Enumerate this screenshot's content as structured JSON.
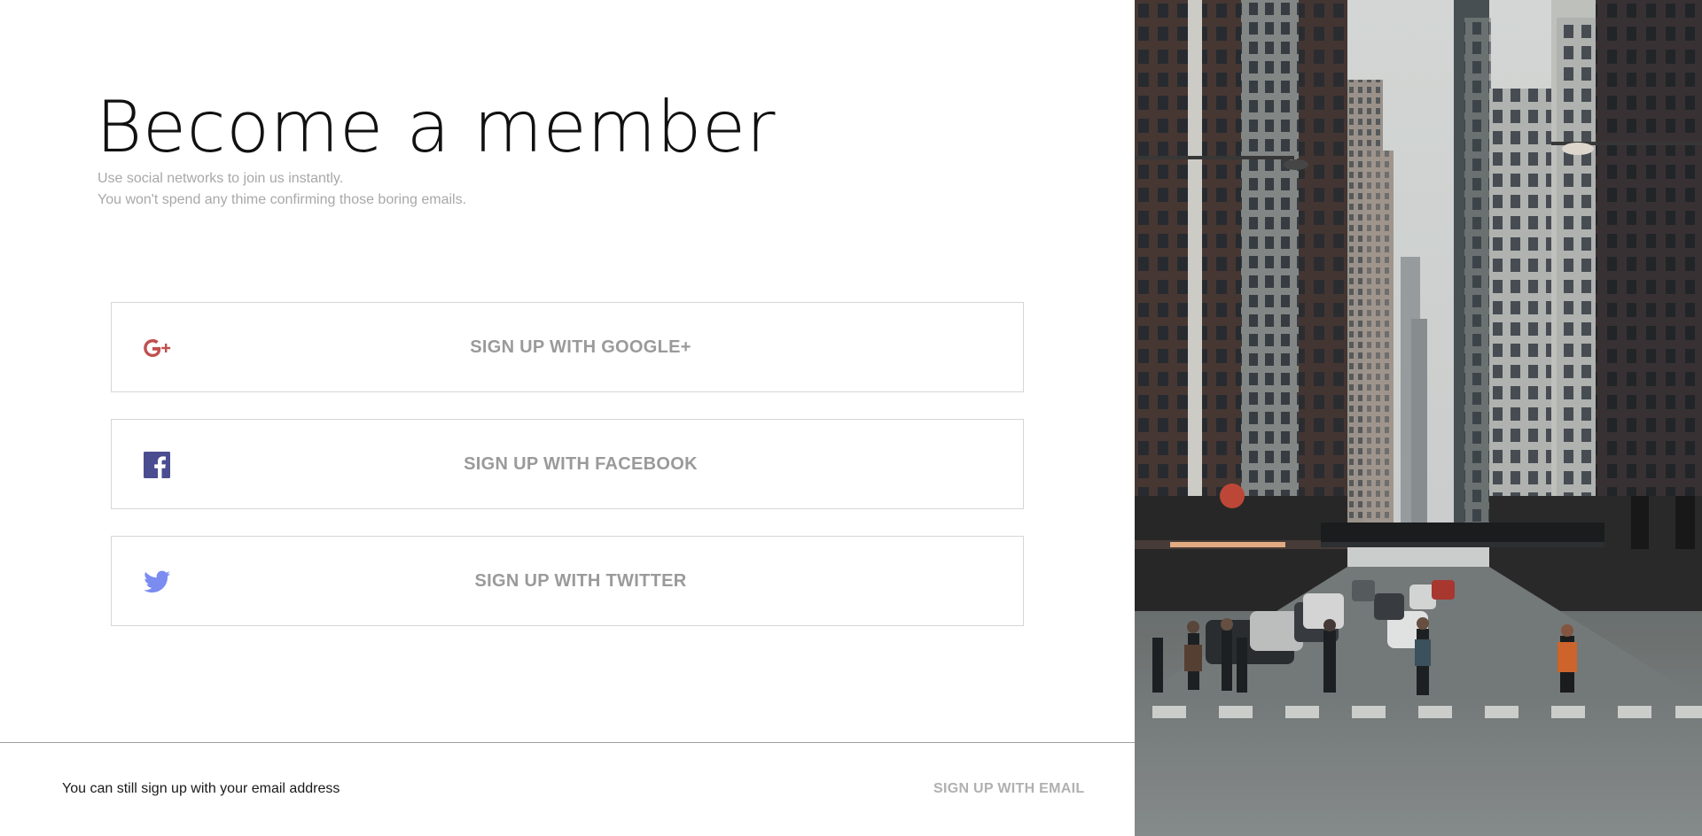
{
  "header": {
    "title": "Become a member",
    "subtitle_line1": "Use social networks to join us instantly.",
    "subtitle_line2": "You won't spend any thime confirming those boring emails."
  },
  "social_buttons": [
    {
      "label": "SIGN UP WITH GOOGLE+",
      "icon": "google-plus-icon",
      "icon_color": "#c0504d"
    },
    {
      "label": "SIGN UP WITH FACEBOOK",
      "icon": "facebook-icon",
      "icon_color": "#4a4d8f"
    },
    {
      "label": "SIGN UP WITH TWITTER",
      "icon": "twitter-icon",
      "icon_color": "#7b8cf0"
    }
  ],
  "footer": {
    "text": "You can still sign up with your email address",
    "email_link": "SIGN UP WITH EMAIL"
  },
  "hero_image": {
    "subject": "city-street-photo"
  }
}
